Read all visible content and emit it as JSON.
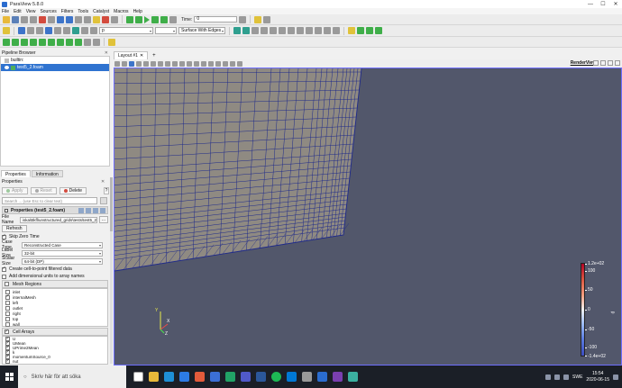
{
  "window": {
    "title": "ParaView 5.8.0",
    "controls": [
      "—",
      "☐",
      "✕"
    ]
  },
  "menu": [
    "File",
    "Edit",
    "View",
    "Sources",
    "Filters",
    "Tools",
    "Catalyst",
    "Macros",
    "Help"
  ],
  "toolbar": {
    "time_label": "Time:",
    "time_value": "0",
    "variable_select": "p",
    "component_select": "",
    "representation": "Surface With Edges"
  },
  "pipeline_browser": {
    "title": "Pipeline Browser",
    "items": [
      {
        "label": "builtin:"
      },
      {
        "label": "test5_2.foam"
      }
    ]
  },
  "panel_tabs": [
    "Properties",
    "Information"
  ],
  "properties": {
    "title": "Properties",
    "buttons": {
      "apply": "Apply",
      "reset": "Reset",
      "delete": "Delete",
      "help": "?"
    },
    "search_placeholder": "Search ... (use Esc to clear text)",
    "section_title": "Properties (test5_2.foam)",
    "file_name_label": "File Name",
    "file_name_value": "iska\\Bkfl\\unstructured_grids\\tests\\test5_2.foam",
    "file_name_browse": "...",
    "refresh_label": "Refresh",
    "skip_zero_time": "Skip Zero Time",
    "case_type_label": "Case Type",
    "case_type_value": "Reconstructed Case",
    "label_size_label": "Label Size",
    "label_size_value": "32-bit",
    "scalar_size_label": "Scalar Size",
    "scalar_size_value": "64-bit (DP)",
    "create_cell_to_point": "Create cell-to-point filtered data",
    "add_dimensional_units": "Add dimensional units to array names",
    "mesh_regions_title": "Mesh Regions",
    "mesh_regions": [
      {
        "name": "inlet",
        "checked": false
      },
      {
        "name": "internalMesh",
        "checked": true
      },
      {
        "name": "left",
        "checked": false
      },
      {
        "name": "outlet",
        "checked": false
      },
      {
        "name": "right",
        "checked": false
      },
      {
        "name": "top",
        "checked": false
      },
      {
        "name": "wall",
        "checked": false
      }
    ],
    "cell_arrays_title": "Cell Arrays",
    "cell_arrays": [
      {
        "name": "U",
        "checked": true
      },
      {
        "name": "UMean",
        "checked": true
      },
      {
        "name": "UPrime2Mean",
        "checked": true
      },
      {
        "name": "k",
        "checked": true
      },
      {
        "name": "momentumSource_0",
        "checked": true
      },
      {
        "name": "nut",
        "checked": true
      }
    ]
  },
  "layout": {
    "tab_label": "Layout #1",
    "view_title": "RenderView1"
  },
  "colorbar": {
    "title": "p",
    "labels": [
      "1.2e+02",
      "100",
      "50",
      "0",
      "-50",
      "-100",
      "-1.4e+02"
    ]
  },
  "axes": {
    "x": "X",
    "y": "Y",
    "z": "Z"
  },
  "taskbar": {
    "search_placeholder": "Skriv här för att söka",
    "language": "SWE",
    "time": "15:54",
    "date": "2020-06-15"
  }
}
